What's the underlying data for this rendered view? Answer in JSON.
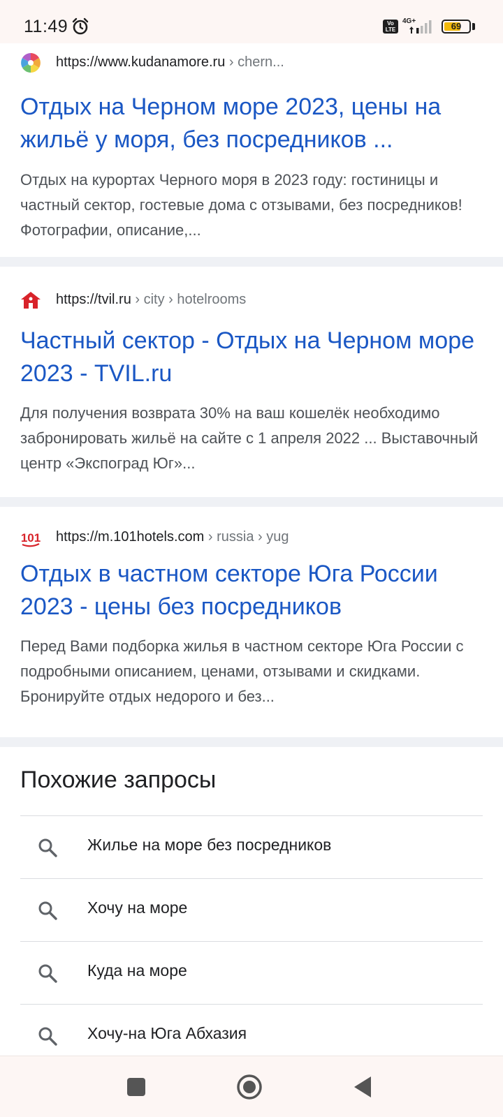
{
  "status_bar": {
    "time": "11:49",
    "network": "4G+",
    "volte": "Vo LTE",
    "battery": "69",
    "battery_level": 0.69,
    "icons": [
      "alarm-icon",
      "volte-icon",
      "signal-icon",
      "battery-icon"
    ]
  },
  "results": [
    {
      "site": "https://www.kudanamore.ru",
      "path": " › chern...",
      "favicon": "kudanamore-favicon",
      "title": "Отдых на Черном море 2023, цены на жильё у моря, без посредников ...",
      "snippet": "Отдых на курортах Черного моря в 2023 году: гостиницы и частный сектор, гостевые дома с отзывами, без посредников! Фотографии, описание,..."
    },
    {
      "site": "https://tvil.ru",
      "path": " › city › hotelrooms",
      "favicon": "tvil-favicon",
      "title": "Частный сектор - Отдых на Черном море 2023 - TVIL.ru",
      "snippet": "Для получения возврата 30% на ваш кошелёк необходимо забронировать жильё на сайте с 1 апреля 2022 ... Выставочный центр «Экспоград Юг»..."
    },
    {
      "site": "https://m.101hotels.com",
      "path": " › russia › yug",
      "favicon": "101hotels-favicon",
      "favicon_text": "101",
      "title": "Отдых в частном секторе Юга России 2023 - цены без посредников",
      "snippet": "Перед Вами подборка жилья в частном секторе Юга России с подробными описанием, ценами, отзывами и скидками. Бронируйте отдых недорого и без..."
    }
  ],
  "related": {
    "heading": "Похожие запросы",
    "items": [
      "Жилье на море без посредников",
      "Хочу на море",
      "Куда на море",
      "Хочу-на Юга Абхазия"
    ]
  },
  "nav_bar": {
    "buttons": [
      "recents-square-icon",
      "home-circle-icon",
      "back-triangle-icon"
    ]
  },
  "colors": {
    "link": "#1a57c4",
    "snippet": "#4d5156",
    "divider": "#eff1f5",
    "system_bar": "#fdf6f4",
    "battery": "#f2b90a"
  }
}
